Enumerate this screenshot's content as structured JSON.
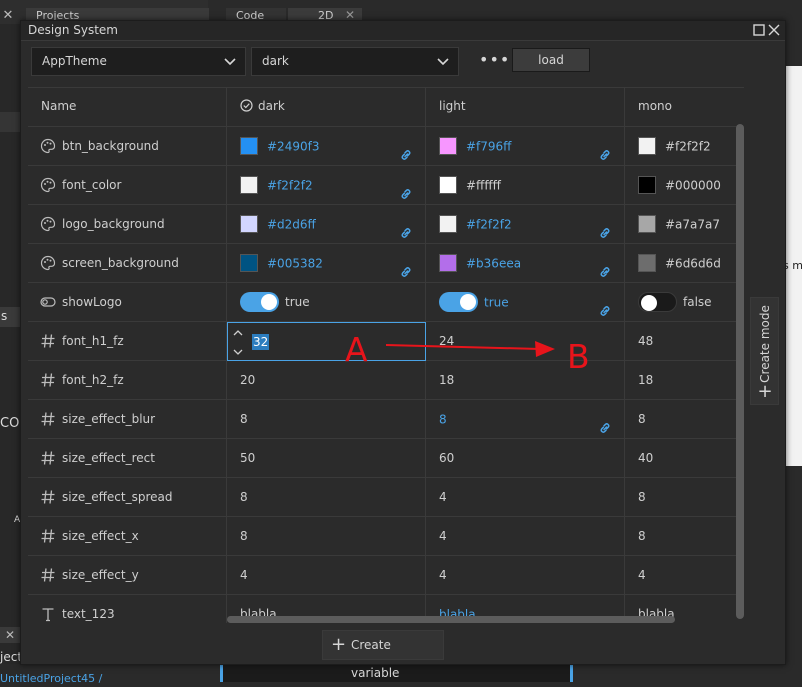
{
  "background": {
    "tab_projects": "Projects",
    "tab_code": "Code",
    "tab_2d": "2D",
    "left_items_s": "s",
    "left_items_co": "CO",
    "left_items_a": "A",
    "left_items_ject": "jecto",
    "breadcrumb": "UntitledProject45 /",
    "right_peek": "s m"
  },
  "window": {
    "title": "Design System",
    "maximize_icon": "maximize-icon",
    "close_icon": "close-icon"
  },
  "toolbar": {
    "collection_select": "AppTheme",
    "mode_select": "dark",
    "more_label": "•••",
    "load_label": "load"
  },
  "columns": {
    "name": "Name",
    "mode1": "dark",
    "mode2": "light",
    "mode3": "mono"
  },
  "rows": [
    {
      "name": "btn_background",
      "type": "color",
      "v1": "#2490f3",
      "v2": "#f796ff",
      "v3": "#f2f2f2",
      "c1": "#2490f3",
      "c2": "#f796ff",
      "c3": "#f2f2f2",
      "l1": true,
      "l2": true,
      "l3": false
    },
    {
      "name": "font_color",
      "type": "color",
      "v1": "#f2f2f2",
      "v2": "#ffffff",
      "v3": "#000000",
      "c1": "#f2f2f2",
      "c2": "#ffffff",
      "c3": "#000000",
      "l1": true,
      "l2": false,
      "l3": false
    },
    {
      "name": "logo_background",
      "type": "color",
      "v1": "#d2d6ff",
      "v2": "#f2f2f2",
      "v3": "#a7a7a7",
      "c1": "#d2d6ff",
      "c2": "#f2f2f2",
      "c3": "#a7a7a7",
      "l1": true,
      "l2": true,
      "l3": false
    },
    {
      "name": "screen_background",
      "type": "color",
      "v1": "#005382",
      "v2": "#b36eea",
      "v3": "#6d6d6d",
      "c1": "#005382",
      "c2": "#b36eea",
      "c3": "#6d6d6d",
      "l1": true,
      "l2": true,
      "l3": false
    },
    {
      "name": "showLogo",
      "type": "bool",
      "v1": "true",
      "v2": "true",
      "v3": "false",
      "l1": false,
      "l2": true,
      "l3": false
    },
    {
      "name": "font_h1_fz",
      "type": "number",
      "v1": "32",
      "v2": "24",
      "v3": "48",
      "editing": true
    },
    {
      "name": "font_h2_fz",
      "type": "number",
      "v1": "20",
      "v2": "18",
      "v3": "18"
    },
    {
      "name": "size_effect_blur",
      "type": "number",
      "v1": "8",
      "v2": "8",
      "v3": "8",
      "l2": true
    },
    {
      "name": "size_effect_rect",
      "type": "number",
      "v1": "50",
      "v2": "60",
      "v3": "40"
    },
    {
      "name": "size_effect_spread",
      "type": "number",
      "v1": "8",
      "v2": "4",
      "v3": "8"
    },
    {
      "name": "size_effect_x",
      "type": "number",
      "v1": "8",
      "v2": "4",
      "v3": "8"
    },
    {
      "name": "size_effect_y",
      "type": "number",
      "v1": "4",
      "v2": "4",
      "v3": "4"
    },
    {
      "name": "text_123",
      "type": "text",
      "v1": "blabla",
      "v2": "blabla",
      "v3": "blabla",
      "l2": true
    }
  ],
  "create_mode_label": "Create mode",
  "create_variable_label": "Create variable",
  "annotation": {
    "label_a": "A",
    "label_b": "B",
    "color": "#e8141b"
  },
  "accent": "#4aa3e6"
}
